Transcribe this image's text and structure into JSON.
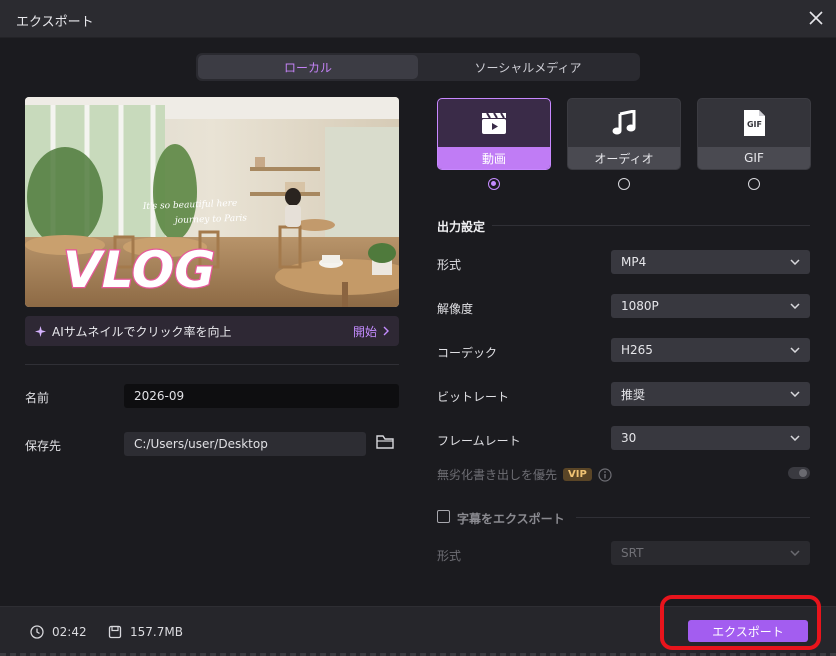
{
  "window": {
    "title": "エクスポート"
  },
  "tabs": [
    {
      "label": "ローカル",
      "active": true
    },
    {
      "label": "ソーシャルメディア",
      "active": false
    }
  ],
  "preview": {
    "overlay_line1": "It's so beautiful here",
    "overlay_line2": "journey to Paris",
    "overlay_title": "VLOG"
  },
  "ai_banner": {
    "label": "AIサムネイルでクリック率を向上",
    "action": "開始"
  },
  "fields": {
    "name_label": "名前",
    "name_value": "2026-09",
    "save_label": "保存先",
    "save_value": "C:/Users/user/Desktop"
  },
  "format_cards": [
    {
      "label": "動画",
      "icon": "video-clapper-icon",
      "selected": true
    },
    {
      "label": "オーディオ",
      "icon": "music-note-icon",
      "selected": false
    },
    {
      "label": "GIF",
      "icon": "gif-file-icon",
      "badge": "GIF",
      "selected": false
    }
  ],
  "output": {
    "title": "出力設定",
    "rows": [
      {
        "label": "形式",
        "value": "MP4"
      },
      {
        "label": "解像度",
        "value": "1080P"
      },
      {
        "label": "コーデック",
        "value": "H265"
      },
      {
        "label": "ビットレート",
        "value": "推奨"
      },
      {
        "label": "フレームレート",
        "value": "30"
      }
    ],
    "lossless_label": "無劣化書き出しを優先",
    "vip_badge": "VIP",
    "lossless_enabled": false,
    "subtitle_label": "字幕をエクスポート",
    "subtitle_checked": false,
    "subtitle_format_label": "形式",
    "subtitle_format_value": "SRT"
  },
  "footer": {
    "duration": "02:42",
    "size": "157.7MB",
    "export_label": "エクスポート"
  },
  "colors": {
    "accent": "#c07cf5",
    "export_button": "#a35df0",
    "highlight_box": "#e8141c"
  }
}
